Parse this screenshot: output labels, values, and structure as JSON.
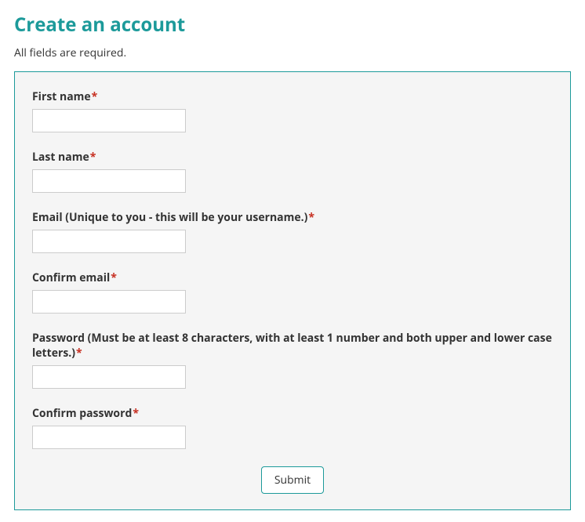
{
  "page": {
    "title": "Create an account",
    "subtitle": "All fields are required."
  },
  "form": {
    "fields": {
      "first_name": {
        "label": "First name",
        "value": ""
      },
      "last_name": {
        "label": "Last name",
        "value": ""
      },
      "email": {
        "label": "Email (Unique to you - this will be your username.)",
        "value": ""
      },
      "confirm_email": {
        "label": "Confirm email",
        "value": ""
      },
      "password": {
        "label": "Password (Must be at least 8 characters, with at least 1 number and both upper and lower case letters.)",
        "value": ""
      },
      "confirm_password": {
        "label": "Confirm password",
        "value": ""
      }
    },
    "required_symbol": "*",
    "submit_label": "Submit"
  }
}
